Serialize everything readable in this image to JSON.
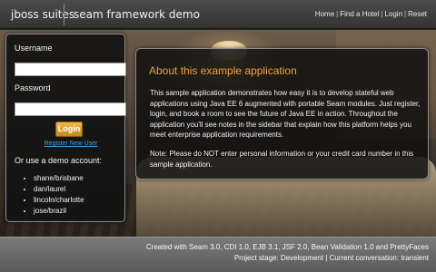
{
  "header": {
    "brand": "jboss suites",
    "subtitle": "seam framework demo",
    "nav": [
      {
        "label": "Home"
      },
      {
        "label": "Find a Hotel"
      },
      {
        "label": "Login"
      },
      {
        "label": "Reset"
      }
    ],
    "nav_separator": "|"
  },
  "login": {
    "username_label": "Username",
    "username_value": "",
    "password_label": "Password",
    "password_value": "",
    "button_label": "Login",
    "register_link": "Register New User",
    "demo_heading": "Or use a demo account:",
    "demo_accounts": [
      "shane/brisbane",
      "dan/laurel",
      "lincoln/charlotte",
      "jose/brazil"
    ]
  },
  "about": {
    "title": "About this example application",
    "paragraph1": "This sample application demonstrates how easy it is to develop stateful web applications using Java EE 6 augmented with portable Seam modules. Just register, login, and book a room to see the future of Java EE in action. Throughout the application you'll see notes in the sidebar that explain how this platform helps you meet enterprise application requirements.",
    "paragraph2": "Note: Please do NOT enter personal information or your credit card number in this sample application."
  },
  "footer": {
    "line1": "Created with Seam 3.0, CDI 1.0, EJB 3.1, JSF 2.0, Bean Validation 1.0 and PrettyFaces",
    "line2": "Project stage: Development | Current conversation: transient"
  },
  "colors": {
    "accent_orange": "#f0a33a",
    "link_blue": "#41a3e0",
    "button_gold": "#e0a234"
  }
}
